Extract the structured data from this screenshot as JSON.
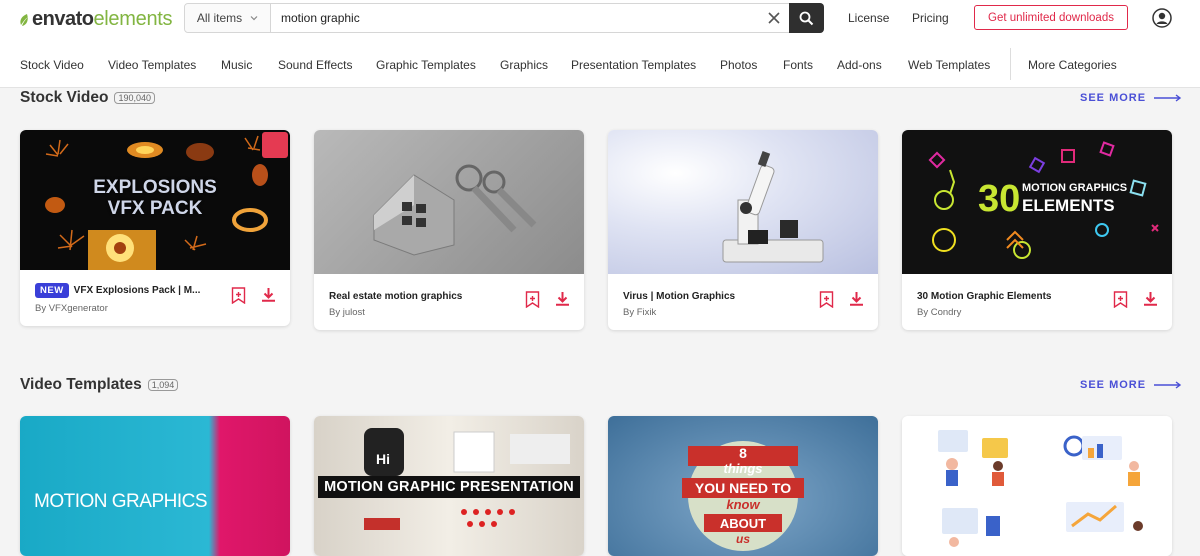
{
  "header": {
    "logo_part1": "envato",
    "logo_part2": "elements",
    "search_scope": "All items",
    "search_value": "motion graphic",
    "license": "License",
    "pricing": "Pricing",
    "cta": "Get unlimited downloads"
  },
  "categories": [
    "Stock Video",
    "Video Templates",
    "Music",
    "Sound Effects",
    "Graphic Templates",
    "Graphics",
    "Presentation Templates",
    "Photos",
    "Fonts",
    "Add-ons",
    "Web Templates",
    "More Categories"
  ],
  "stock_video": {
    "title": "Stock Video",
    "count": "190,040",
    "see_more": "SEE MORE",
    "cards": [
      {
        "badge": "NEW",
        "title": "VFX Explosions Pack | M...",
        "author": "By VFXgenerator",
        "thumb_text_1": "EXPLOSIONS",
        "thumb_text_2": "VFX PACK"
      },
      {
        "title": "Real estate motion graphics",
        "author": "By julost"
      },
      {
        "title": "Virus | Motion Graphics",
        "author": "By Fixik"
      },
      {
        "title": "30 Motion Graphic Elements",
        "author": "By Condry",
        "thumb_text_1": "30",
        "thumb_text_2": "MOTION GRAPHICS",
        "thumb_text_3": "ELEMENTS"
      }
    ]
  },
  "video_templates": {
    "title": "Video Templates",
    "count": "1,094",
    "see_more": "SEE MORE",
    "cards": [
      {
        "thumb_text_1": "MOTION GRAPHICS"
      },
      {
        "thumb_text_1": "MOTION GRAPHIC PRESENTATION",
        "thumb_text_2": "Hi"
      },
      {
        "thumb_text_1": "8",
        "thumb_text_2": "things",
        "thumb_text_3": "YOU NEED TO",
        "thumb_text_4": "know",
        "thumb_text_5": "ABOUT",
        "thumb_text_6": "us"
      },
      {}
    ]
  },
  "colors": {
    "brand_green": "#82b541",
    "cta_red": "#e0294a",
    "accent_blue": "#4a4fd6",
    "download_red": "#e0294a"
  }
}
